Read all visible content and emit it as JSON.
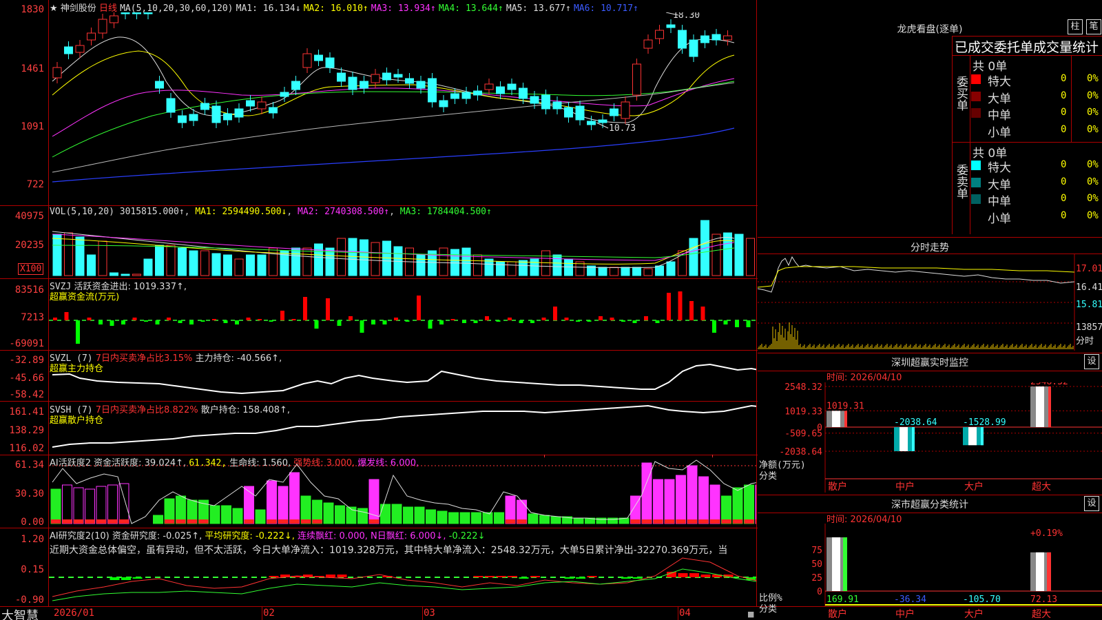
{
  "stock": {
    "name": "神剑股份",
    "period": "日线",
    "corner_mark": "★"
  },
  "price_panel": {
    "ma_label": "MA(5,10,20,30,60,120)",
    "ma1": "MA1: 16.134↓",
    "ma2": "MA2: 16.010↑",
    "ma3": "MA3: 13.934↑",
    "ma4": "MA4: 13.644↑",
    "ma5": "MA5: 13.677↑",
    "ma6": "MA6: 10.717↑",
    "y_ticks": [
      "1830",
      "1461",
      "1091",
      "722"
    ],
    "high_note": "18.30",
    "low_note": "10.73"
  },
  "vol_panel": {
    "label": "VOL(5,10,20)",
    "value": "3015815.000↑",
    "ma1": "MA1: 2594490.500↓",
    "ma2": "MA2: 2740308.500↑",
    "ma3": "MA3: 1784404.500↑",
    "y_ticks": [
      "40975",
      "20235"
    ],
    "unit": "X100"
  },
  "svzj_panel": {
    "label": "SVZJ",
    "active": "活跃资金进出: 1019.337↑,",
    "sub": "超赢资金流(万元)",
    "y_ticks": [
      "83516",
      "7213",
      "-69091"
    ]
  },
  "svzl_panel": {
    "label": "SVZL (7)",
    "ratio": "7日内买卖净占比3.15%",
    "main": "主力持仓: -40.566↑,",
    "sub": "超赢主力持仓",
    "y_ticks": [
      "-32.89",
      "-45.66",
      "-58.42"
    ]
  },
  "svsh_panel": {
    "label": "SVSH (7)",
    "ratio": "7日内买卖净占比8.822%",
    "main": "散户持仓: 158.408↑,",
    "sub": "超赢散户持仓",
    "y_ticks": [
      "161.41",
      "138.29",
      "116.02"
    ]
  },
  "ai_active_panel": {
    "label": "AI活跃度2",
    "fund": "资金活跃度: 39.024↑,",
    "v2": "61.342,",
    "life": "生命线: 1.560,",
    "strong": "强势线: 3.000,",
    "burst": "爆发线: 6.000,",
    "y_ticks": [
      "61.34",
      "30.30",
      "0.00"
    ]
  },
  "ai_research_panel": {
    "label": "AI研究度2(10)",
    "res": "资金研究度: -0.025↑,",
    "avg": "平均研究度: -0.222↓,",
    "cont": "连续飘红: 0.000,",
    "n": "N日飘红: 6.000↓,",
    "last": "-0.222↓",
    "comment": "近期大资金总体偏空，虽有异动，但不太活跃，今日大单净流入：1019.328万元，其中特大单净流入：2548.32万元，大单5日累计净出-32270.369万元，当",
    "y_ticks": [
      "1.20",
      "0.15",
      "-0.90"
    ]
  },
  "x_axis": {
    "app_label": "大智慧",
    "dates": [
      "2026/01",
      "02",
      "03",
      "04"
    ]
  },
  "dragon_tiger": {
    "title": "龙虎看盘(逐单)",
    "btn_bar": "柱",
    "btn_pen": "笔",
    "tabs": "已成交委托单成交量统计",
    "buy_group": "委买单",
    "sell_group": "委卖单",
    "buy_total": "共 0单",
    "sell_total": "共 0单",
    "buy_rows": [
      {
        "name": "特大",
        "count": "0",
        "pct": "0%",
        "color": "#ff0000"
      },
      {
        "name": "大单",
        "count": "0",
        "pct": "0%",
        "color": "#880000"
      },
      {
        "name": "中单",
        "count": "0",
        "pct": "0%",
        "color": "#660000"
      },
      {
        "name": "小单",
        "count": "0",
        "pct": "0%",
        "color": ""
      }
    ],
    "sell_rows": [
      {
        "name": "特大",
        "count": "0",
        "pct": "0%",
        "color": "#00ffff"
      },
      {
        "name": "大单",
        "count": "0",
        "pct": "0%",
        "color": "#008080"
      },
      {
        "name": "中单",
        "count": "0",
        "pct": "0%",
        "color": "#006060"
      },
      {
        "name": "小单",
        "count": "0",
        "pct": "0%",
        "color": ""
      }
    ]
  },
  "intraday": {
    "title": "分时走势",
    "prices": [
      "17.01",
      "16.41",
      "15.81"
    ],
    "vol": "13857",
    "vol_unit": "分时"
  },
  "sz_monitor": {
    "title": "深圳超赢实时监控",
    "set_btn": "设",
    "time_label": "时间: 2026/04/10",
    "y_ticks": [
      "2548.32",
      "1019.33",
      "0",
      "-509.65",
      "-2038.64"
    ],
    "ylabel": "净额(万元)",
    "xlabel": "分类",
    "bars": [
      {
        "cat": "散户",
        "value": 1019.31,
        "label": "1019.31",
        "color": "#ff3333",
        "label_color": "#ff3333"
      },
      {
        "cat": "中户",
        "value": -2038.64,
        "label": "-2038.64",
        "color": "#33ffff",
        "label_color": "#33ffff"
      },
      {
        "cat": "大户",
        "value": -1528.99,
        "label": "-1528.99",
        "color": "#33ffff",
        "label_color": "#33ffff"
      },
      {
        "cat": "超大",
        "value": 2548.32,
        "label": "2548.32",
        "color": "#ff3333",
        "label_color": "#ff3333"
      }
    ]
  },
  "sz_class": {
    "title": "深市超赢分类统计",
    "set_btn": "设",
    "time_label": "时间: 2026/04/10",
    "y_ticks": [
      "75",
      "50",
      "25",
      "0"
    ],
    "ylabel": "比例%",
    "xlabel": "分类",
    "pct_note": "+0.19%",
    "bars": [
      {
        "cat": "散户",
        "value": 169.91,
        "label": "169.91",
        "height_pct": 100,
        "color": "#33ff33",
        "label_color": "#33ff33"
      },
      {
        "cat": "中户",
        "value": -36.34,
        "label": "-36.34",
        "height_pct": 0,
        "color": "#3b5bff",
        "label_color": "#3b5bff"
      },
      {
        "cat": "大户",
        "value": -105.7,
        "label": "-105.70",
        "height_pct": 0,
        "color": "#33ffff",
        "label_color": "#33ffff"
      },
      {
        "cat": "超大",
        "value": 72.13,
        "label": "72.13",
        "height_pct": 72,
        "color": "#ff3333",
        "label_color": "#ff3333"
      }
    ]
  }
}
